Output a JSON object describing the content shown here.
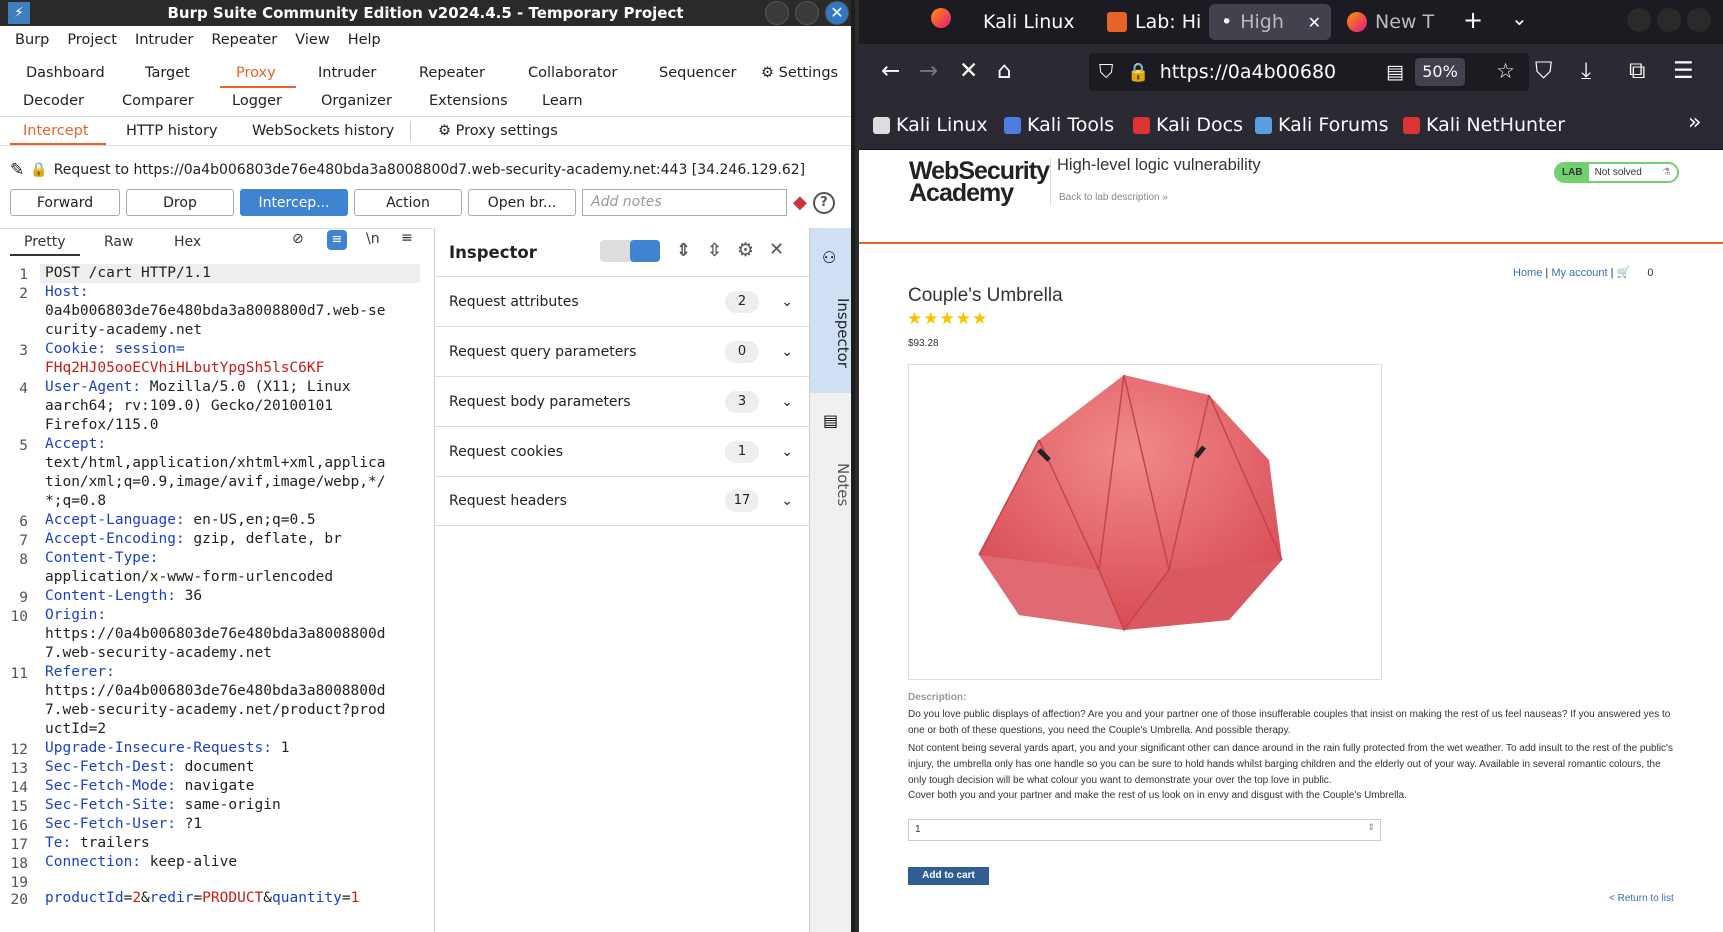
{
  "burp": {
    "title": "Burp Suite Community Edition v2024.4.5 - Temporary Project",
    "menu": [
      "Burp",
      "Project",
      "Intruder",
      "Repeater",
      "View",
      "Help"
    ],
    "tools_row1": [
      "Dashboard",
      "Target",
      "Proxy",
      "Intruder",
      "Repeater",
      "Collaborator",
      "Sequencer",
      "Settings"
    ],
    "tools_row2": [
      "Decoder",
      "Comparer",
      "Logger",
      "Organizer",
      "Extensions",
      "Learn"
    ],
    "sub_tabs": [
      "Intercept",
      "HTTP history",
      "WebSockets history",
      "Proxy settings"
    ],
    "request_line": "Request to https://0a4b006803de76e480bda3a8008800d7.web-security-academy.net:443  [34.246.129.62]",
    "buttons": {
      "forward": "Forward",
      "drop": "Drop",
      "intercept": "Intercep...",
      "action": "Action",
      "open_browser": "Open br..."
    },
    "notes_placeholder": "Add notes",
    "editor_tabs": [
      "Pretty",
      "Raw",
      "Hex"
    ],
    "newline_toggle": "\\n",
    "code_lines": [
      {
        "n": "1",
        "text": "POST /cart HTTP/1.1"
      },
      {
        "n": "2",
        "key": "Host",
        "val": "\n0a4b006803de76e480bda3a8008800d7.web-se\ncurity-academy.net"
      },
      {
        "n": "3",
        "key": "Cookie",
        "val": "session=\nFHq2HJ05ooECVhiHLbutYpgSh5lsC6KF"
      },
      {
        "n": "4",
        "key": "User-Agent",
        "val": "Mozilla/5.0 (X11; Linux\naarch64; rv:109.0) Gecko/20100101\nFirefox/115.0"
      },
      {
        "n": "5",
        "key": "Accept",
        "val": "\ntext/html,application/xhtml+xml,applica\ntion/xml;q=0.9,image/avif,image/webp,*/\n*;q=0.8"
      },
      {
        "n": "6",
        "key": "Accept-Language",
        "val": "en-US,en;q=0.5"
      },
      {
        "n": "7",
        "key": "Accept-Encoding",
        "val": "gzip, deflate, br"
      },
      {
        "n": "8",
        "key": "Content-Type",
        "val": "\napplication/x-www-form-urlencoded"
      },
      {
        "n": "9",
        "key": "Content-Length",
        "val": "36"
      },
      {
        "n": "10",
        "key": "Origin",
        "val": "\nhttps://0a4b006803de76e480bda3a8008800d\n7.web-security-academy.net"
      },
      {
        "n": "11",
        "key": "Referer",
        "val": "\nhttps://0a4b006803de76e480bda3a8008800d\n7.web-security-academy.net/product?prod\nuctId=2"
      },
      {
        "n": "12",
        "key": "Upgrade-Insecure-Requests",
        "val": "1"
      },
      {
        "n": "13",
        "key": "Sec-Fetch-Dest",
        "val": "document"
      },
      {
        "n": "14",
        "key": "Sec-Fetch-Mode",
        "val": "navigate"
      },
      {
        "n": "15",
        "key": "Sec-Fetch-Site",
        "val": "same-origin"
      },
      {
        "n": "16",
        "key": "Sec-Fetch-User",
        "val": "?1"
      },
      {
        "n": "17",
        "key": "Te",
        "val": "trailers"
      },
      {
        "n": "18",
        "key": "Connection",
        "val": "keep-alive"
      },
      {
        "n": "19",
        "text": ""
      },
      {
        "n": "20",
        "body": [
          [
            "productId",
            "2"
          ],
          [
            "redir",
            "PRODUCT"
          ],
          [
            "quantity",
            "1"
          ]
        ]
      }
    ],
    "inspector": {
      "title": "Inspector",
      "rows": [
        {
          "label": "Request attributes",
          "count": "2"
        },
        {
          "label": "Request query parameters",
          "count": "0"
        },
        {
          "label": "Request body parameters",
          "count": "3"
        },
        {
          "label": "Request cookies",
          "count": "1"
        },
        {
          "label": "Request headers",
          "count": "17"
        }
      ]
    },
    "sidebar": {
      "inspector": "Inspector",
      "notes": "Notes"
    }
  },
  "firefox": {
    "tabs": [
      "Kali Linux",
      "Lab: Hi",
      "High",
      "New T"
    ],
    "url": "https://0a4b00680",
    "zoom": "50%",
    "bookmarks": [
      "Kali Linux",
      "Kali Tools",
      "Kali Docs",
      "Kali Forums",
      "Kali NetHunter"
    ],
    "page": {
      "logo_line1": "WebSecurity",
      "logo_line2": "Academy",
      "lab_title": "High-level logic vulnerability",
      "back_link": "Back to lab description  »",
      "lab_badge": "LAB",
      "lab_status": "Not solved",
      "nav_home": "Home",
      "nav_account": "My account",
      "cart_count": "0",
      "product_title": "Couple's Umbrella",
      "stars": "★★★★★",
      "price": "$93.28",
      "desc_heading": "Description:",
      "desc1": "Do you love public displays of affection? Are you and your partner one of those insufferable couples that insist on making the rest of us feel nauseas? If you answered yes to one or both of these questions, you need the Couple's Umbrella. And possible therapy.",
      "desc2": "Not content being several yards apart, you and your significant other can dance around in the rain fully protected from the wet weather. To add insult to the rest of the public's injury, the umbrella only has one handle so you can be sure to hold hands whilst barging children and the elderly out of your way. Available in several romantic colours, the only tough decision will be what colour you want to demonstrate your over the top love in public.",
      "desc3": "Cover both you and your partner and make the rest of us look on in envy and disgust with the Couple's Umbrella.",
      "quantity": "1",
      "add_to_cart": "Add to cart",
      "return": "< Return to list"
    }
  }
}
